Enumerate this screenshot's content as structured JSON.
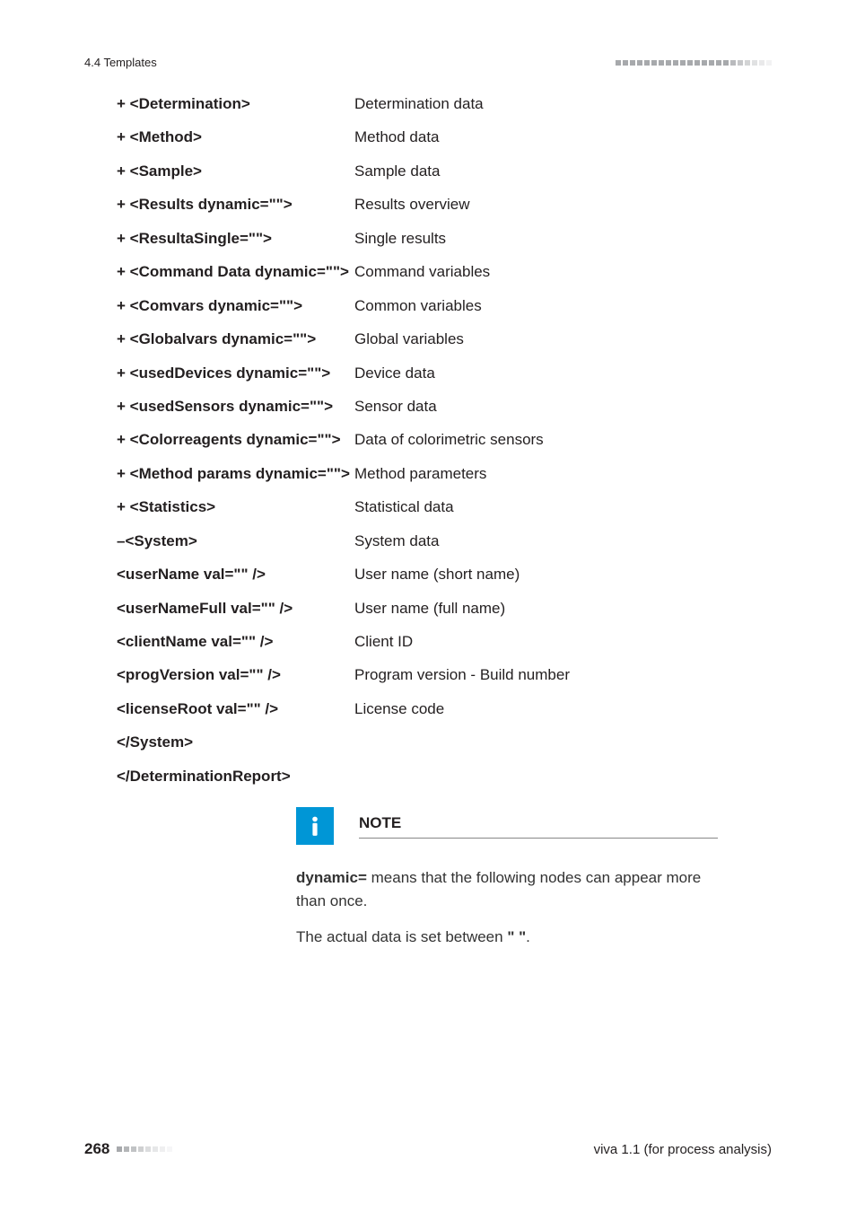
{
  "header": {
    "section": "4.4 Templates"
  },
  "rows": [
    {
      "left": "+ <Determination>",
      "right": "Determination data"
    },
    {
      "left": "+ <Method>",
      "right": "Method data"
    },
    {
      "left": "+ <Sample>",
      "right": "Sample data"
    },
    {
      "left": "+ <Results dynamic=\"\">",
      "right": "Results overview"
    },
    {
      "left": "+ <ResultaSingle=\"\">",
      "right": "Single results"
    },
    {
      "left": "+ <Command Data dynamic=\"\">",
      "right": "Command variables"
    },
    {
      "left": "+ <Comvars dynamic=\"\">",
      "right": "Common variables"
    },
    {
      "left": "+ <Globalvars dynamic=\"\">",
      "right": "Global variables"
    },
    {
      "left": "+ <usedDevices dynamic=\"\">",
      "right": "Device data"
    },
    {
      "left": "+ <usedSensors dynamic=\"\">",
      "right": "Sensor data"
    },
    {
      "left": "+ <Colorreagents dynamic=\"\">",
      "right": "Data of colorimetric sensors"
    },
    {
      "left": "+ <Method params dynamic=\"\">",
      "right": "Method parameters"
    },
    {
      "left": "+ <Statistics>",
      "right": "Statistical data"
    },
    {
      "left": "–<System>",
      "right": "System data"
    },
    {
      "left": "<userName val=\"\" />",
      "right": "User name (short name)"
    },
    {
      "left": "<userNameFull val=\"\" />",
      "right": "User name (full name)"
    },
    {
      "left": "<clientName val=\"\" />",
      "right": "Client ID"
    },
    {
      "left": "<progVersion val=\"\" />",
      "right": "Program version - Build number"
    },
    {
      "left": "<licenseRoot val=\"\" />",
      "right": "License code"
    },
    {
      "left": "</System>",
      "right": ""
    },
    {
      "left": "</DeterminationReport>",
      "right": ""
    }
  ],
  "note": {
    "title": "NOTE",
    "line1_bold": "dynamic=",
    "line1_rest": " means that the following nodes can appear more than once.",
    "line2_pre": "The actual data is set between ",
    "line2_bold": "\" \"",
    "line2_post": "."
  },
  "footer": {
    "page": "268",
    "right": "viva 1.1 (for process analysis)"
  }
}
